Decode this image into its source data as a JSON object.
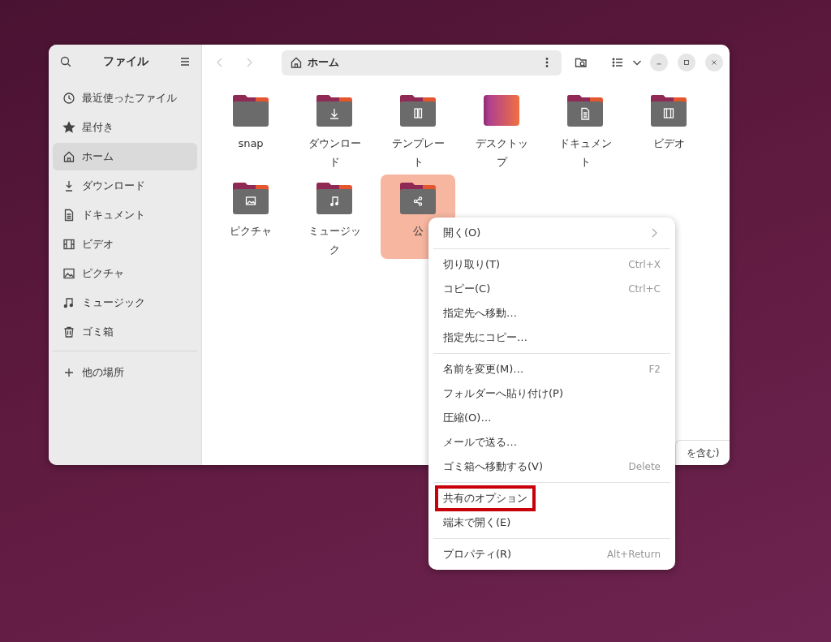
{
  "sidebar": {
    "title": "ファイル",
    "items": [
      {
        "label": "最近使ったファイル",
        "kind": "recent",
        "selected": false
      },
      {
        "label": "星付き",
        "kind": "star",
        "selected": false
      },
      {
        "label": "ホーム",
        "kind": "home",
        "selected": true
      },
      {
        "label": "ダウンロード",
        "kind": "download",
        "selected": false
      },
      {
        "label": "ドキュメント",
        "kind": "document",
        "selected": false
      },
      {
        "label": "ビデオ",
        "kind": "video",
        "selected": false
      },
      {
        "label": "ピクチャ",
        "kind": "picture",
        "selected": false
      },
      {
        "label": "ミュージック",
        "kind": "music",
        "selected": false
      },
      {
        "label": "ゴミ箱",
        "kind": "trash",
        "selected": false
      }
    ],
    "other": {
      "label": "他の場所"
    }
  },
  "pathbar": {
    "location": "ホーム"
  },
  "folders": [
    {
      "name": "snap",
      "kind": "plain",
      "selected": false
    },
    {
      "name": "ダウンロード",
      "kind": "download",
      "selected": false
    },
    {
      "name": "テンプレート",
      "kind": "template",
      "selected": false
    },
    {
      "name": "デスクトップ",
      "kind": "desktop",
      "selected": false
    },
    {
      "name": "ドキュメント",
      "kind": "document",
      "selected": false
    },
    {
      "name": "ビデオ",
      "kind": "video",
      "selected": false
    },
    {
      "name": "ピクチャ",
      "kind": "picture",
      "selected": false
    },
    {
      "name": "ミュージック",
      "kind": "music",
      "selected": false
    },
    {
      "name": "公",
      "kind": "share",
      "selected": true
    }
  ],
  "status_bar": "を含む)",
  "context_menu": {
    "sections": [
      [
        {
          "label": "開く(O)",
          "submenu": true
        }
      ],
      [
        {
          "label": "切り取り(T)",
          "shortcut": "Ctrl+X"
        },
        {
          "label": "コピー(C)",
          "shortcut": "Ctrl+C"
        },
        {
          "label": "指定先へ移動…"
        },
        {
          "label": "指定先にコピー…"
        }
      ],
      [
        {
          "label": "名前を変更(M)…",
          "shortcut": "F2"
        },
        {
          "label": "フォルダーへ貼り付け(P)"
        },
        {
          "label": "圧縮(O)…"
        },
        {
          "label": "メールで送る…"
        },
        {
          "label": "ゴミ箱へ移動する(V)",
          "shortcut": "Delete"
        }
      ],
      [
        {
          "label": "共有のオプション",
          "highlighted": true
        },
        {
          "label": "端末で開く(E)"
        }
      ],
      [
        {
          "label": "プロパティ(R)",
          "shortcut": "Alt+Return"
        }
      ]
    ]
  }
}
